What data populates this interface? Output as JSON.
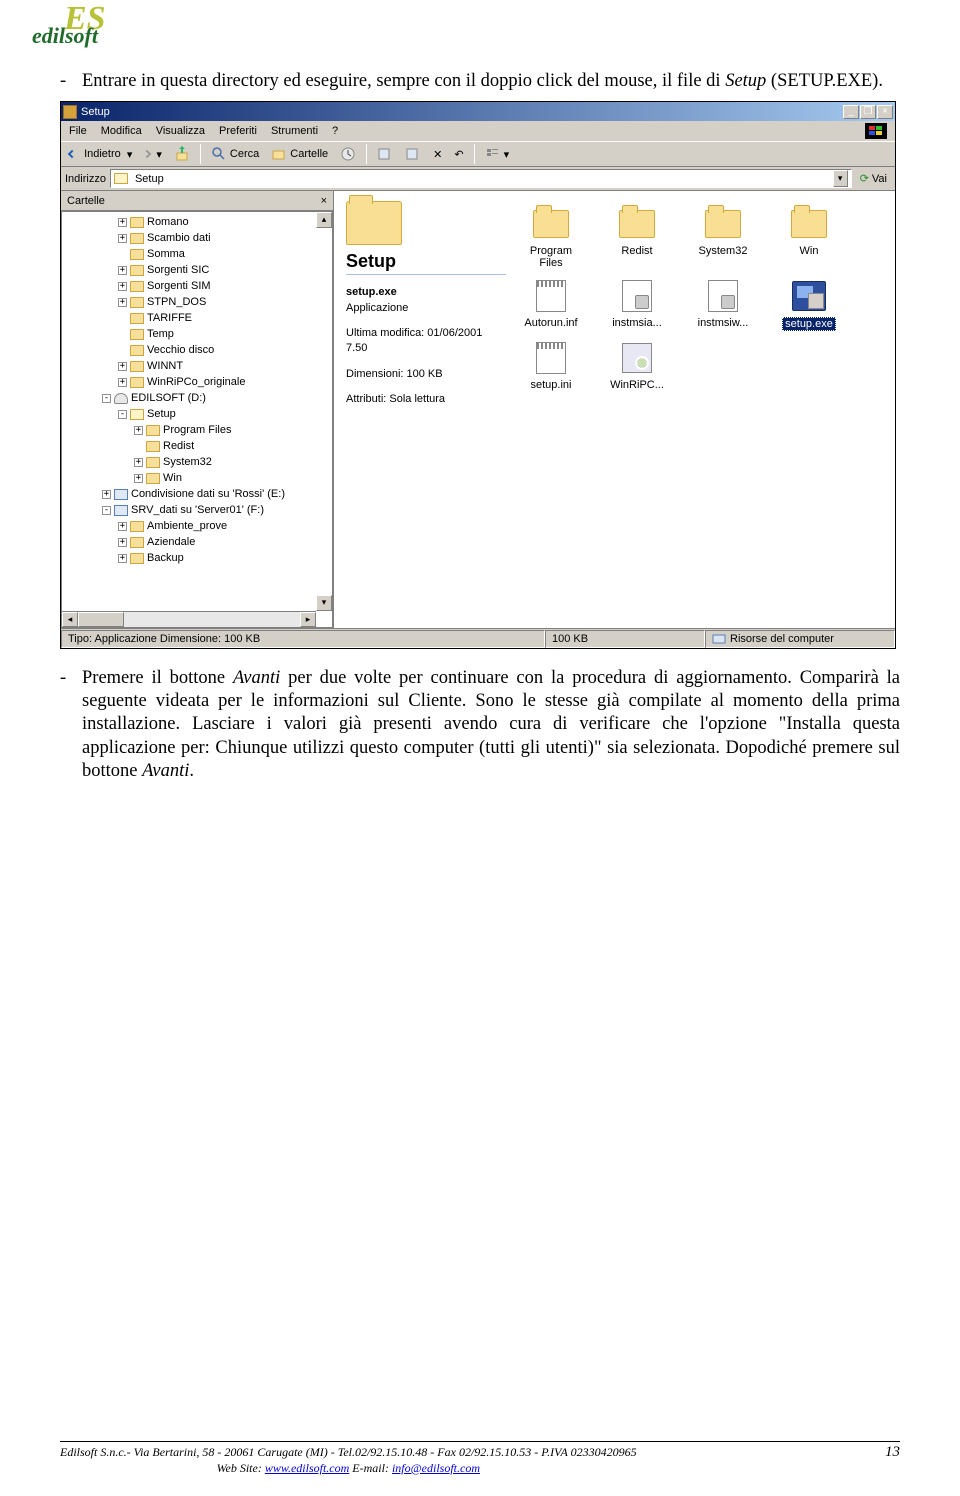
{
  "logo": {
    "text": "edilsoft",
    "es": "ES"
  },
  "para1": {
    "a": "Entrare in questa directory ed eseguire, sempre con il doppio click del mouse, il file di ",
    "b": "Setup",
    "c": " (SETUP.EXE)."
  },
  "para2": {
    "a": "Premere il bottone ",
    "b": "Avanti",
    "c": " per due volte per continuare con la procedura di aggiornamento. Comparirà la seguente videata per le informazioni sul Cliente. Sono le stesse già compilate al momento della prima installazione. Lasciare i valori già presenti avendo cura di verificare che l'opzione \"Installa questa applicazione per: Chiunque utilizzi questo computer (tutti gli utenti)\" sia selezionata. Dopodiché premere sul bottone ",
    "d": "Avanti",
    "e": "."
  },
  "screenshot": {
    "title": "Setup",
    "menu": [
      "File",
      "Modifica",
      "Visualizza",
      "Preferiti",
      "Strumenti",
      "?"
    ],
    "toolbar": {
      "back": "Indietro",
      "search": "Cerca",
      "folders": "Cartelle"
    },
    "address": {
      "label": "Indirizzo",
      "value": "Setup",
      "go": "Vai"
    },
    "treeHeader": "Cartelle",
    "tree": [
      {
        "d": 2,
        "p": "+",
        "i": "f",
        "t": "Romano"
      },
      {
        "d": 2,
        "p": "+",
        "i": "f",
        "t": "Scambio dati"
      },
      {
        "d": 2,
        "p": " ",
        "i": "f",
        "t": "Somma"
      },
      {
        "d": 2,
        "p": "+",
        "i": "f",
        "t": "Sorgenti SIC"
      },
      {
        "d": 2,
        "p": "+",
        "i": "f",
        "t": "Sorgenti SIM"
      },
      {
        "d": 2,
        "p": "+",
        "i": "f",
        "t": "STPN_DOS"
      },
      {
        "d": 2,
        "p": " ",
        "i": "f",
        "t": "TARIFFE"
      },
      {
        "d": 2,
        "p": " ",
        "i": "f",
        "t": "Temp"
      },
      {
        "d": 2,
        "p": " ",
        "i": "f",
        "t": "Vecchio disco"
      },
      {
        "d": 2,
        "p": "+",
        "i": "f",
        "t": "WINNT"
      },
      {
        "d": 2,
        "p": "+",
        "i": "f",
        "t": "WinRiPCo_originale"
      },
      {
        "d": 1,
        "p": "-",
        "i": "d",
        "t": "EDILSOFT (D:)"
      },
      {
        "d": 2,
        "p": "-",
        "i": "o",
        "t": "Setup"
      },
      {
        "d": 3,
        "p": "+",
        "i": "f",
        "t": "Program Files"
      },
      {
        "d": 3,
        "p": " ",
        "i": "f",
        "t": "Redist"
      },
      {
        "d": 3,
        "p": "+",
        "i": "f",
        "t": "System32"
      },
      {
        "d": 3,
        "p": "+",
        "i": "f",
        "t": "Win"
      },
      {
        "d": 1,
        "p": "+",
        "i": "n",
        "t": "Condivisione dati su 'Rossi' (E:)"
      },
      {
        "d": 1,
        "p": "-",
        "i": "n",
        "t": "SRV_dati su 'Server01' (F:)"
      },
      {
        "d": 2,
        "p": "+",
        "i": "f",
        "t": "Ambiente_prove"
      },
      {
        "d": 2,
        "p": "+",
        "i": "f",
        "t": "Aziendale"
      },
      {
        "d": 2,
        "p": "+",
        "i": "f",
        "t": "Backup"
      }
    ],
    "info": {
      "title": "Setup",
      "exe": "setup.exe",
      "app": "Applicazione",
      "mod": "Ultima modifica: 01/06/2001 7.50",
      "dim": "Dimensioni: 100 KB",
      "attr": "Attributi: Sola lettura"
    },
    "files": [
      {
        "type": "folder",
        "name": "Program Files"
      },
      {
        "type": "folder",
        "name": "Redist"
      },
      {
        "type": "folder",
        "name": "System32"
      },
      {
        "type": "folder",
        "name": "Win"
      },
      {
        "type": "notepad",
        "name": "Autorun.inf"
      },
      {
        "type": "cfg",
        "name": "instmsia..."
      },
      {
        "type": "cfg",
        "name": "instmsiw..."
      },
      {
        "type": "exe",
        "name": "setup.exe",
        "selected": true
      },
      {
        "type": "notepad",
        "name": "setup.ini"
      },
      {
        "type": "winripc",
        "name": "WinRiPC..."
      }
    ],
    "status": {
      "left": "Tipo: Applicazione Dimensione: 100 KB",
      "mid": "100 KB",
      "right": "Risorse del computer"
    }
  },
  "footer": {
    "line1a": "Edilsoft S.n.c.- Via Bertarini, 58 - 20061 Carugate (MI) - Tel.02/92.15.10.48 - Fax 02/92.15.10.53 - P.IVA 02330420965",
    "line2a": "Web Site: ",
    "line2b": "www.edilsoft.com",
    "line2c": "   E-mail: ",
    "line2d": "info@edilsoft.com",
    "page": "13"
  }
}
